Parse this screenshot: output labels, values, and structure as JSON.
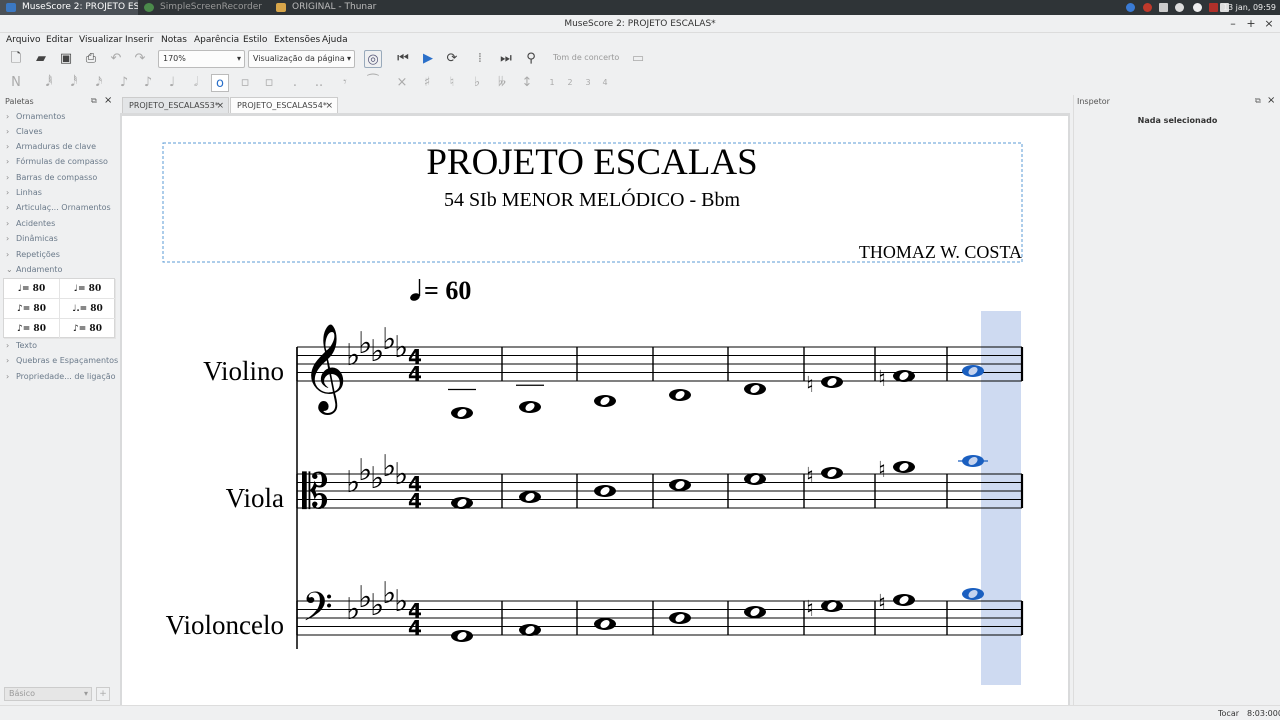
{
  "taskbar": {
    "tasks": [
      {
        "label": "MuseScore 2: PROJETO ESC...",
        "active": true
      },
      {
        "label": "SimpleScreenRecorder",
        "active": false
      },
      {
        "label": "ORIGINAL - Thunar",
        "active": false
      }
    ],
    "clock": "13 jan, 09:59"
  },
  "window": {
    "title": "MuseScore 2: PROJETO ESCALAS*"
  },
  "menu": [
    "Arquivo",
    "Editar",
    "Visualizar",
    "Inserir",
    "Notas",
    "Aparência",
    "Estilo",
    "Extensões",
    "Ajuda"
  ],
  "toolbar": {
    "zoom": "170%",
    "view_mode": "Visualização da página",
    "concert_pitch": "Tom de concerto",
    "voices": [
      "1",
      "2",
      "3",
      "4"
    ]
  },
  "palettes": {
    "title": "Paletas",
    "items": [
      "Ornamentos",
      "Claves",
      "Armaduras de clave",
      "Fórmulas de compasso",
      "Barras de compasso",
      "Linhas",
      "Articulaç... Ornamentos",
      "Acidentes",
      "Dinâmicas",
      "Repetições",
      "Andamento"
    ],
    "items_after": [
      "Texto",
      "Quebras e Espaçamentos",
      "Propriedade... de ligação"
    ],
    "tempo_cells": [
      "♩= 80",
      "♩= 80",
      "♪= 80",
      "♩.= 80",
      "♪= 80",
      "♪= 80"
    ],
    "workspace": "Básico"
  },
  "tabs": [
    {
      "label": "PROJETO_ESCALAS53*",
      "active": false
    },
    {
      "label": "PROJETO_ESCALAS54*",
      "active": true
    }
  ],
  "score": {
    "title": "PROJETO ESCALAS",
    "subtitle": "54 SIb MENOR MELÓDICO - Bbm",
    "composer": "THOMAZ W. COSTA",
    "tempo_text": "= 60",
    "instruments": [
      "Violino",
      "Viola",
      "Violoncelo"
    ],
    "time_signature": "4/4"
  },
  "inspector": {
    "title": "Inspetor",
    "status": "Nada selecionado"
  },
  "status": {
    "mode": "Tocar",
    "position": "8:03:000"
  },
  "colors": {
    "selection": "#c5d3ee",
    "selected_note": "#1a5fc0",
    "frame_dashed": "#5b9bd5"
  }
}
